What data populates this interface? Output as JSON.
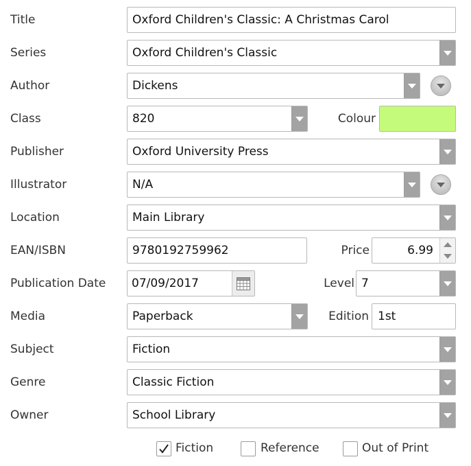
{
  "form": {
    "title": {
      "label": "Title",
      "value": "Oxford Children's Classic: A Christmas Carol"
    },
    "series": {
      "label": "Series",
      "value": "Oxford Children's Classic"
    },
    "author": {
      "label": "Author",
      "value": "Dickens"
    },
    "class": {
      "label": "Class",
      "value": "820"
    },
    "colour": {
      "label": "Colour",
      "value": "#c5fb7a"
    },
    "publisher": {
      "label": "Publisher",
      "value": "Oxford University Press"
    },
    "illustrator": {
      "label": "Illustrator",
      "value": "N/A"
    },
    "location": {
      "label": "Location",
      "value": "Main Library"
    },
    "ean": {
      "label": "EAN/ISBN",
      "value": "9780192759962"
    },
    "price": {
      "label": "Price",
      "value": "6.99"
    },
    "pubdate": {
      "label": "Publication Date",
      "value": "07/09/2017"
    },
    "level": {
      "label": "Level",
      "value": "7"
    },
    "media": {
      "label": "Media",
      "value": "Paperback"
    },
    "edition": {
      "label": "Edition",
      "value": "1st"
    },
    "subject": {
      "label": "Subject",
      "value": "Fiction"
    },
    "genre": {
      "label": "Genre",
      "value": "Classic Fiction"
    },
    "owner": {
      "label": "Owner",
      "value": "School Library"
    }
  },
  "checkboxes": [
    {
      "label": "Fiction",
      "checked": true
    },
    {
      "label": "Reference",
      "checked": false
    },
    {
      "label": "Out of Print",
      "checked": false
    }
  ],
  "icons": {
    "dropdown": "chevron-down-icon",
    "expand": "circle-chevron-down-icon",
    "calendar": "calendar-icon",
    "spinner": "spinner-arrows-icon",
    "check": "checkmark-icon"
  }
}
